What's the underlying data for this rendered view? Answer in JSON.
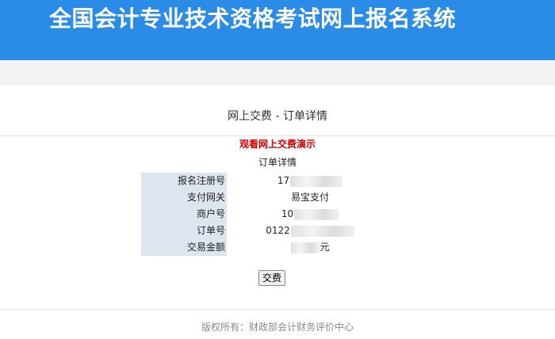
{
  "header": {
    "title": "全国会计专业技术资格考试网上报名系统"
  },
  "page": {
    "title": "网上交费 - 订单详情",
    "demo_link": "观看网上交费演示",
    "section_title": "订单详情"
  },
  "order": {
    "rows": [
      {
        "label": "报名注册号",
        "value": "17",
        "redacted": true
      },
      {
        "label": "支付网关",
        "value": "易宝支付",
        "redacted": false
      },
      {
        "label": "商户号",
        "value": "10",
        "redacted": true
      },
      {
        "label": "订单号",
        "value": "0122",
        "redacted": true
      },
      {
        "label": "交易金额",
        "value": "元",
        "redacted": true
      }
    ]
  },
  "actions": {
    "pay_label": "交费"
  },
  "footer": {
    "copyright": "版权所有：财政部会计财务评价中心"
  },
  "colors": {
    "header_bg": "#2a8ce6",
    "label_bg": "#dde5ee",
    "demo_link": "#d40000"
  }
}
